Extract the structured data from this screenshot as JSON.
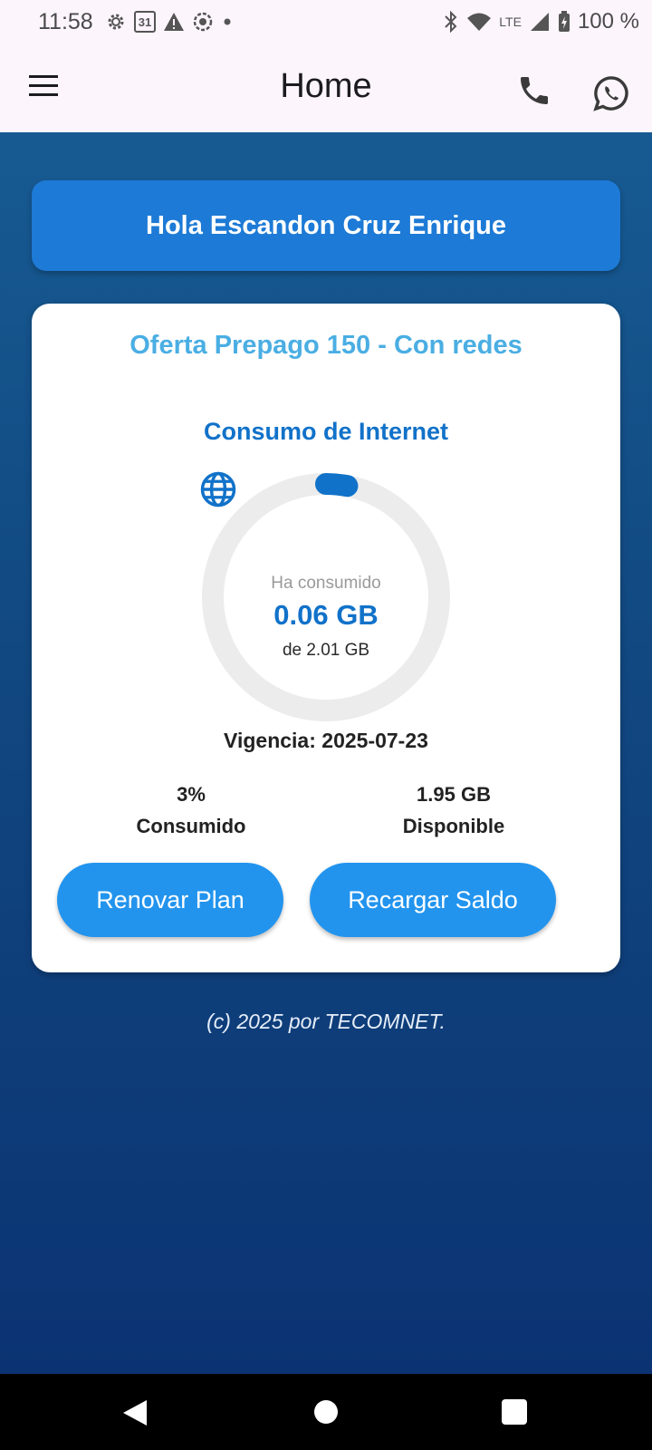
{
  "status_bar": {
    "time": "11:58",
    "calendar_day": "31",
    "network": "LTE",
    "battery": "100 %"
  },
  "app_bar": {
    "title": "Home",
    "icons": [
      "menu-icon",
      "phone-icon",
      "whatsapp-icon"
    ]
  },
  "greeting": "Hola Escandon Cruz Enrique",
  "plan": {
    "name": "Oferta Prepago 150 - Con redes",
    "consumption_title": "Consumo de Internet",
    "consumed_label": "Ha consumido",
    "consumed_value": "0.06 GB",
    "total_label": "de 2.01 GB",
    "consumed_fraction": 0.03,
    "validity": "Vigencia: 2025-07-23",
    "stats": {
      "percent_value": "3%",
      "percent_label": "Consumido",
      "available_value": "1.95 GB",
      "available_label": "Disponible"
    },
    "buttons": {
      "renew": "Renovar Plan",
      "recharge": "Recargar Saldo"
    }
  },
  "footer": "(c) 2025 por TECOMNET.",
  "colors": {
    "accent": "#1172c9",
    "button": "#2294ee",
    "plan_name": "#4aaee3",
    "gauge_track": "#ececec"
  }
}
